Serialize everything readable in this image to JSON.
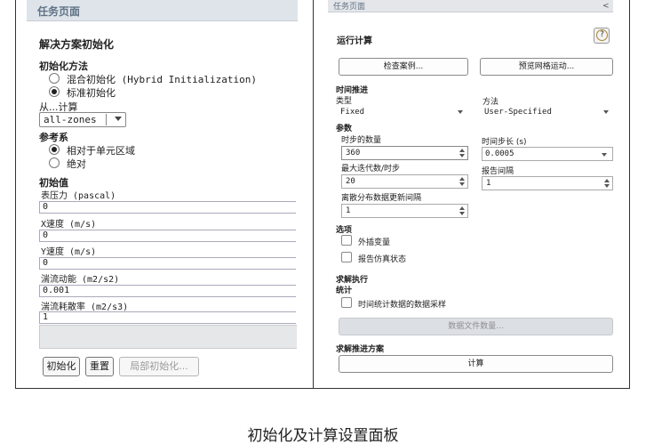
{
  "left_panel": {
    "header": "任务页面",
    "title": "解决方案初始化",
    "init_method": {
      "label": "初始化方法",
      "options": [
        "混合初始化 (Hybrid Initialization)",
        "标准初始化"
      ],
      "selected": "标准初始化"
    },
    "compute_from": {
      "label": "从...计算",
      "value": "all-zones"
    },
    "reference_frame": {
      "label": "参考系",
      "options": [
        "相对于单元区域",
        "绝对"
      ],
      "selected": "相对于单元区域"
    },
    "initial_values": {
      "label": "初始值",
      "fields": [
        {
          "label": "表压力 (pascal)",
          "value": "0"
        },
        {
          "label": "X速度 (m/s)",
          "value": "0"
        },
        {
          "label": "Y速度 (m/s)",
          "value": "0"
        },
        {
          "label": "湍流动能 (m2/s2)",
          "value": "0.001"
        },
        {
          "label": "湍流耗散率 (m2/s3)",
          "value": "1"
        }
      ]
    },
    "buttons": {
      "initialize": "初始化",
      "reset": "重置",
      "patch": "局部初始化..."
    }
  },
  "right_panel": {
    "header": "任务页面",
    "collapse_glyph": "<",
    "title": "运行计算",
    "help_glyph": "?",
    "buttons": {
      "check_case": "检查案例...",
      "preview_mesh_motion": "预览网格运动..."
    },
    "time_advancement": {
      "label": "时间推进",
      "type_label": "类型",
      "type_value": "Fixed",
      "method_label": "方法",
      "method_value": "User-Specified"
    },
    "parameters": {
      "label": "参数",
      "num_time_steps_label": "时步的数量",
      "num_time_steps": "360",
      "time_step_size_label": "时间步长 (s)",
      "time_step_size": "0.0005",
      "max_iterations_label": "最大迭代数/时步",
      "max_iterations": "20",
      "reporting_interval_label": "报告间隔",
      "reporting_interval": "1",
      "profile_update_label": "离散分布数据更新间隔",
      "profile_update": "1"
    },
    "options": {
      "label": "选项",
      "extrapolate": "外插变量",
      "report_simulation_status": "报告仿真状态"
    },
    "solution_processing": {
      "label": "求解执行",
      "statistics_label": "统计",
      "data_sampling": "时间统计数据的数据采样",
      "data_file_quantities": "数据文件数量..."
    },
    "advancement": {
      "label": "求解推进方案",
      "calculate": "计算"
    }
  },
  "caption": "初始化及计算设置面板"
}
